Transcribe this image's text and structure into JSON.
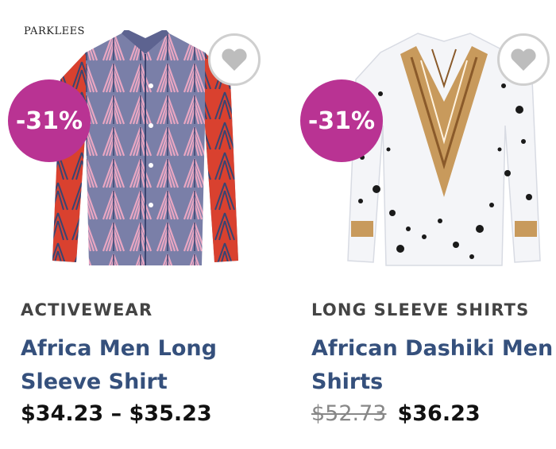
{
  "products": [
    {
      "brand_label": "PARKLEES",
      "discount_badge": "-31%",
      "category": "ACTIVEWEAR",
      "title": "Africa Men Long Sleeve Shirt",
      "price_range": "$34.23 – $35.23",
      "image_icon": "african-print-long-sleeve-shirt",
      "wishlist_icon": "heart-icon",
      "colors": {
        "badge": "#b93393",
        "title": "#35507c",
        "shirt_primary": "#7a7fa8",
        "shirt_accent": "#d9412f"
      }
    },
    {
      "discount_badge": "-31%",
      "category": "LONG SLEEVE SHIRTS",
      "title": "African Dashiki Men Long Sleeve Shirts",
      "old_price": "$52.73",
      "price": "$36.23",
      "image_icon": "dashiki-long-sleeve-shirt",
      "wishlist_icon": "heart-icon",
      "colors": {
        "badge": "#b93393",
        "title": "#35507c",
        "shirt_primary": "#f4f5f8",
        "shirt_accent": "#c89a5c"
      }
    }
  ]
}
